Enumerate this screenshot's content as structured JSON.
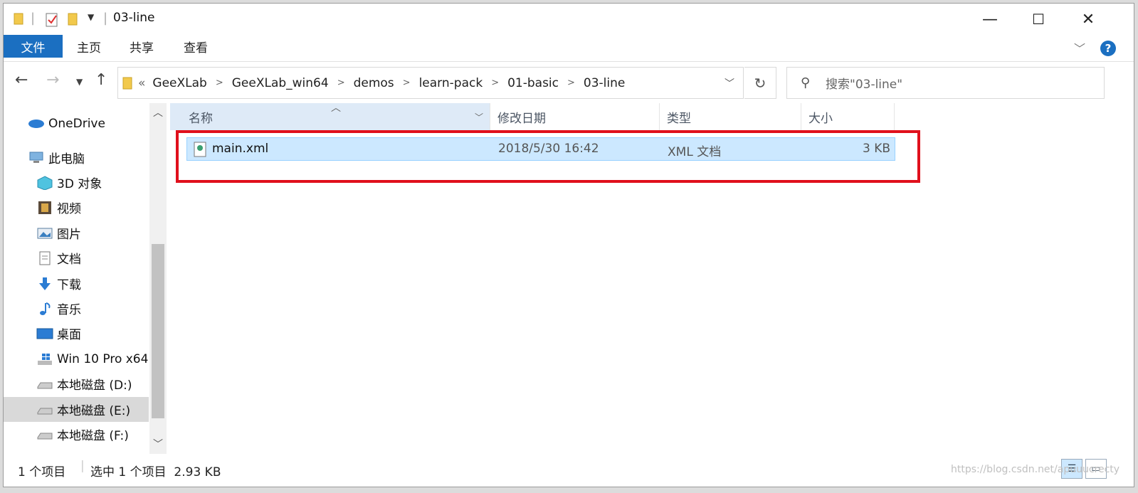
{
  "window": {
    "title": "03-line"
  },
  "titlebar": {
    "minimize": "—",
    "maximize": "☐",
    "close": "✕"
  },
  "ribbon": {
    "tabs": [
      "文件",
      "主页",
      "共享",
      "查看"
    ],
    "help": "?"
  },
  "address": {
    "crumbs": [
      "GeeXLab",
      "GeeXLab_win64",
      "demos",
      "learn-pack",
      "01-basic",
      "03-line"
    ],
    "prefix": "«",
    "search_placeholder": "搜索\"03-line\""
  },
  "nav": {
    "items": [
      {
        "label": "OneDrive",
        "icon": "cloud-icon"
      },
      {
        "label": "此电脑",
        "icon": "computer-icon"
      },
      {
        "label": "3D 对象",
        "icon": "cube-icon"
      },
      {
        "label": "视频",
        "icon": "film-icon"
      },
      {
        "label": "图片",
        "icon": "image-icon"
      },
      {
        "label": "文档",
        "icon": "document-icon"
      },
      {
        "label": "下载",
        "icon": "download-arrow-icon"
      },
      {
        "label": "音乐",
        "icon": "music-note-icon"
      },
      {
        "label": "桌面",
        "icon": "desktop-icon"
      },
      {
        "label": "Win 10 Pro x64",
        "icon": "windows-drive-icon"
      },
      {
        "label": "本地磁盘 (D:)",
        "icon": "drive-icon"
      },
      {
        "label": "本地磁盘 (E:)",
        "icon": "drive-icon"
      },
      {
        "label": "本地磁盘 (F:)",
        "icon": "drive-icon"
      }
    ],
    "selected_index": 11
  },
  "columns": {
    "name": "名称",
    "modified": "修改日期",
    "type": "类型",
    "size": "大小"
  },
  "files": [
    {
      "name": "main.xml",
      "modified": "2018/5/30 16:42",
      "type": "XML 文档",
      "size": "3 KB"
    }
  ],
  "status": {
    "count": "1 个项目",
    "selection": "选中 1 个项目  2.93 KB"
  },
  "watermark": "https://blog.csdn.net/apuuucrecty",
  "colors": {
    "accent": "#1b6fc1",
    "selection": "#cce8ff",
    "highlight": "#e0101c"
  }
}
